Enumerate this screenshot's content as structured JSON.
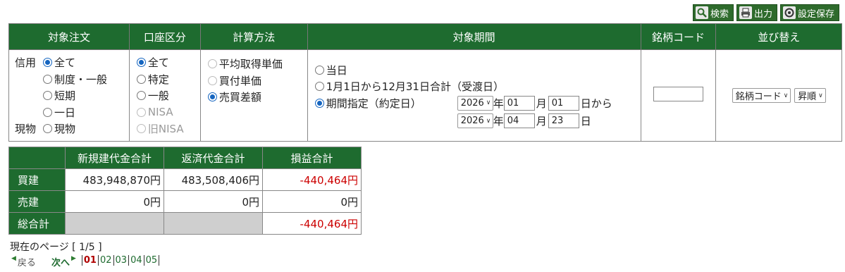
{
  "toolbar": {
    "search_label": "検索",
    "print_label": "出力",
    "save_label": "設定保存"
  },
  "filter": {
    "headers": [
      "対象注文",
      "口座区分",
      "計算方法",
      "対象期間",
      "銘柄コード",
      "並び替え"
    ],
    "order": {
      "shinyo_label": "信用",
      "genbutsu_label": "現物",
      "options": [
        "全て",
        "制度・一般",
        "短期",
        "一日"
      ],
      "genbutsu_option": "現物"
    },
    "account": {
      "options": [
        "全て",
        "特定",
        "一般",
        "NISA",
        "旧NISA"
      ]
    },
    "calc": {
      "options": [
        "平均取得単価",
        "買付単価",
        "売買差額"
      ]
    },
    "period": {
      "options": [
        "当日",
        "1月1日から12月31日合計（受渡日）",
        "期間指定（約定日）"
      ],
      "from_year": "2026",
      "from_month": "01",
      "from_day": "01",
      "to_year": "2026",
      "to_month": "04",
      "to_day": "23",
      "year_unit": "年",
      "month_unit": "月",
      "from_suffix": "日から",
      "to_suffix": "日"
    },
    "code": {
      "value": ""
    },
    "sort": {
      "field": "銘柄コード",
      "order": "昇順"
    }
  },
  "summary": {
    "headers": [
      "",
      "新規建代金合計",
      "返済代金合計",
      "損益合計"
    ],
    "rows": [
      {
        "label": "買建",
        "new": "483,948,870円",
        "close": "483,508,406円",
        "pl": "-440,464円"
      },
      {
        "label": "売建",
        "new": "0円",
        "close": "0円",
        "pl": "0円"
      },
      {
        "label": "総合計",
        "new": "",
        "close": "",
        "pl": "-440,464円"
      }
    ]
  },
  "pagination": {
    "info": "現在のページ [ 1/5 ]",
    "prev_label": "戻る",
    "next_label": "次へ",
    "pages": [
      "01",
      "02",
      "03",
      "04",
      "05"
    ]
  },
  "colors": {
    "header_green": "#1e6b2f",
    "negative": "#cc0000"
  }
}
